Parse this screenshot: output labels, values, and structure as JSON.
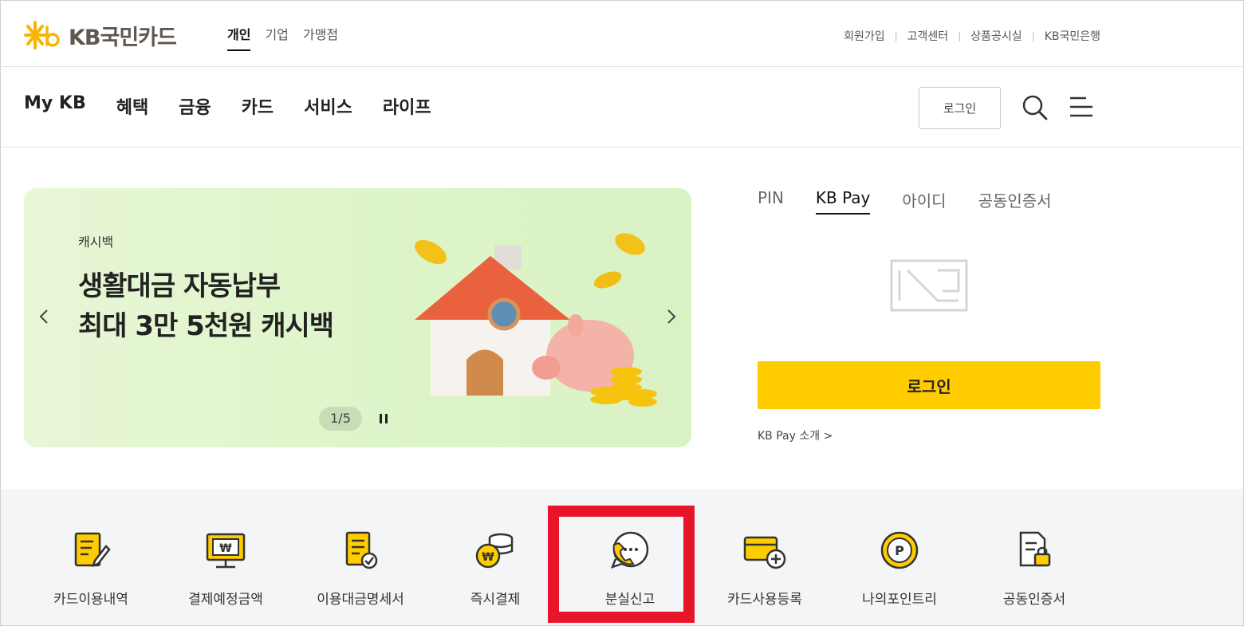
{
  "brand": {
    "logo_text": "KB국민카드"
  },
  "segments": [
    {
      "label": "개인",
      "active": true
    },
    {
      "label": "기업",
      "active": false
    },
    {
      "label": "가맹점",
      "active": false
    }
  ],
  "utility_links": [
    "회원가입",
    "고객센터",
    "상품공시실",
    "KB국민은행"
  ],
  "main_menu": [
    "My KB",
    "혜택",
    "금융",
    "카드",
    "서비스",
    "라이프"
  ],
  "header": {
    "login_label": "로그인"
  },
  "banner": {
    "tag": "캐시백",
    "title_line1": "생활대금 자동납부",
    "title_line2": "최대 3만 5천원 캐시백",
    "pager": "1/5"
  },
  "login_panel": {
    "tabs": [
      {
        "label": "PIN",
        "active": false
      },
      {
        "label": "KB Pay",
        "active": true
      },
      {
        "label": "아이디",
        "active": false
      },
      {
        "label": "공동인증서",
        "active": false
      }
    ],
    "login_button": "로그인",
    "kbpay_intro_link": "KB Pay 소개 >"
  },
  "quick_menu": [
    {
      "label": "카드이용내역",
      "icon": "card-history-icon"
    },
    {
      "label": "결제예정금액",
      "icon": "payment-due-icon"
    },
    {
      "label": "이용대금명세서",
      "icon": "statement-icon"
    },
    {
      "label": "즉시결제",
      "icon": "instant-pay-icon"
    },
    {
      "label": "분실신고",
      "icon": "lost-report-icon"
    },
    {
      "label": "카드사용등록",
      "icon": "card-register-icon"
    },
    {
      "label": "나의포인트리",
      "icon": "point-icon"
    },
    {
      "label": "공동인증서",
      "icon": "certificate-icon"
    }
  ],
  "colors": {
    "brand_yellow": "#ffcc00",
    "highlight_red": "#e8142a",
    "banner_green": "#e0f5cd"
  }
}
